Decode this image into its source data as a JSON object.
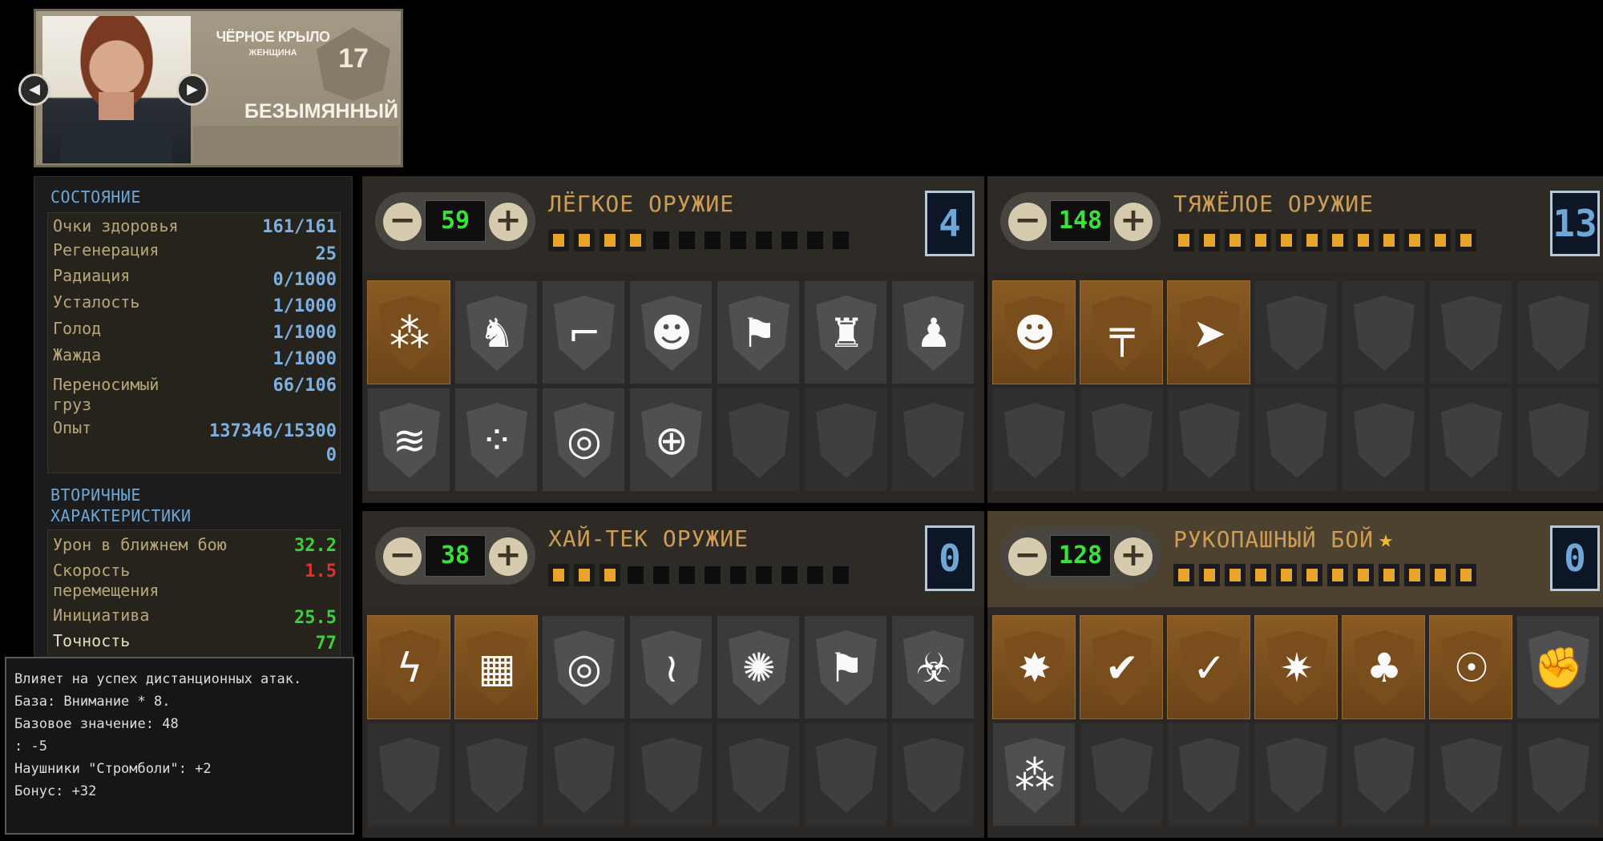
{
  "character": {
    "faction": "ЧЁРНОЕ КРЫЛО",
    "gender": "ЖЕНЩИНА",
    "level": "17",
    "name": "БЕЗЫМЯННЫЙ",
    "prev_icon": "chevron-left-icon",
    "next_icon": "chevron-right-icon"
  },
  "status": {
    "title": "СОСТОЯНИЕ",
    "rows": [
      {
        "label": "Очки здоровья",
        "value": "161/161"
      },
      {
        "label": "Регенерация",
        "value": "25"
      },
      {
        "label": "Радиация",
        "value": "0/1000"
      },
      {
        "label": "Усталость",
        "value": "1/1000"
      },
      {
        "label": "Голод",
        "value": "1/1000"
      },
      {
        "label": "Жажда",
        "value": "1/1000"
      },
      {
        "label": "Переносимый груз",
        "value": "66/106"
      },
      {
        "label": "Опыт",
        "value": "137346/153000"
      }
    ]
  },
  "secondary": {
    "title": "ВТОРИЧНЫЕ ХАРАКТЕРИСТИКИ",
    "rows": [
      {
        "label": "Урон в ближнем бою",
        "value": "32.2",
        "color": "#39d23a"
      },
      {
        "label": "Скорость перемещения",
        "value": "1.5",
        "color": "#e03030"
      },
      {
        "label": "Инициатива",
        "value": "25.5",
        "color": "#39d23a"
      },
      {
        "label": "Точность",
        "value": "77",
        "color": "#39d23a"
      }
    ]
  },
  "tooltip": {
    "lines": [
      "Влияет на успех дистанционных атак.",
      "База: Внимание * 8.",
      "",
      "Базовое значение: 48",
      ": -5",
      "Наушники \"Стромболи\": +2",
      "Бонус: +32"
    ]
  },
  "skills": [
    {
      "title": "ЛЁГКОЕ ОРУЖИЕ",
      "value": "59",
      "points": "4",
      "pips_filled": 4,
      "pips_total": 12,
      "starred": false,
      "perks": [
        {
          "icon": "gatling-icon",
          "state": "unlocked"
        },
        {
          "icon": "crouching-shooter-icon",
          "state": "available"
        },
        {
          "icon": "pistol-grip-icon",
          "state": "available"
        },
        {
          "icon": "headshot-icon",
          "state": "available"
        },
        {
          "icon": "arm-shot-icon",
          "state": "available"
        },
        {
          "icon": "ammo-soldier-icon",
          "state": "available"
        },
        {
          "icon": "kneeling-soldier-icon",
          "state": "available"
        },
        {
          "icon": "lightning-bullets-icon",
          "state": "available"
        },
        {
          "icon": "spray-icon",
          "state": "available"
        },
        {
          "icon": "target-icon",
          "state": "available"
        },
        {
          "icon": "crosshair-icon",
          "state": "available"
        },
        {
          "icon": "empty-slot-icon",
          "state": "empty"
        },
        {
          "icon": "empty-slot-icon",
          "state": "empty"
        },
        {
          "icon": "empty-slot-icon",
          "state": "empty"
        }
      ]
    },
    {
      "title": "ТЯЖЁЛОЕ ОРУЖИЕ",
      "value": "148",
      "points": "13",
      "pips_filled": 12,
      "pips_total": 12,
      "starred": false,
      "perks": [
        {
          "icon": "headshot-icon",
          "state": "unlocked"
        },
        {
          "icon": "smg-icon",
          "state": "unlocked"
        },
        {
          "icon": "rocket-icon",
          "state": "unlocked"
        },
        {
          "icon": "empty-slot-icon",
          "state": "empty"
        },
        {
          "icon": "empty-slot-icon",
          "state": "empty"
        },
        {
          "icon": "empty-slot-icon",
          "state": "empty"
        },
        {
          "icon": "empty-slot-icon",
          "state": "empty"
        },
        {
          "icon": "empty-slot-icon",
          "state": "empty"
        },
        {
          "icon": "empty-slot-icon",
          "state": "empty"
        },
        {
          "icon": "empty-slot-icon",
          "state": "empty"
        },
        {
          "icon": "empty-slot-icon",
          "state": "empty"
        },
        {
          "icon": "empty-slot-icon",
          "state": "empty"
        },
        {
          "icon": "empty-slot-icon",
          "state": "empty"
        },
        {
          "icon": "empty-slot-icon",
          "state": "empty"
        }
      ]
    },
    {
      "title": "ХАЙ-ТЕК ОРУЖИЕ",
      "value": "38",
      "points": "0",
      "pips_filled": 3,
      "pips_total": 12,
      "starred": false,
      "perks": [
        {
          "icon": "lightning-icon",
          "state": "unlocked"
        },
        {
          "icon": "chip-icon",
          "state": "unlocked"
        },
        {
          "icon": "target-icon",
          "state": "available"
        },
        {
          "icon": "heat-waves-icon",
          "state": "available"
        },
        {
          "icon": "burst-icon",
          "state": "available"
        },
        {
          "icon": "arm-shot-icon",
          "state": "available"
        },
        {
          "icon": "biohazard-icon",
          "state": "available"
        },
        {
          "icon": "empty-slot-icon",
          "state": "empty"
        },
        {
          "icon": "empty-slot-icon",
          "state": "empty"
        },
        {
          "icon": "empty-slot-icon",
          "state": "empty"
        },
        {
          "icon": "empty-slot-icon",
          "state": "empty"
        },
        {
          "icon": "empty-slot-icon",
          "state": "empty"
        },
        {
          "icon": "empty-slot-icon",
          "state": "empty"
        },
        {
          "icon": "empty-slot-icon",
          "state": "empty"
        }
      ]
    },
    {
      "title": "РУКОПАШНЫЙ БОЙ",
      "value": "128",
      "points": "0",
      "pips_filled": 12,
      "pips_total": 12,
      "starred": true,
      "perks": [
        {
          "icon": "impact-icon",
          "state": "unlocked"
        },
        {
          "icon": "check-icon",
          "state": "unlocked"
        },
        {
          "icon": "circled-check-icon",
          "state": "unlocked"
        },
        {
          "icon": "smash-icon",
          "state": "unlocked"
        },
        {
          "icon": "brass-knuckles-icon",
          "state": "unlocked"
        },
        {
          "icon": "double-punch-icon",
          "state": "unlocked"
        },
        {
          "icon": "fist-icon",
          "state": "available"
        },
        {
          "icon": "rocks-icon",
          "state": "available"
        },
        {
          "icon": "empty-slot-icon",
          "state": "empty"
        },
        {
          "icon": "empty-slot-icon",
          "state": "empty"
        },
        {
          "icon": "empty-slot-icon",
          "state": "empty"
        },
        {
          "icon": "empty-slot-icon",
          "state": "empty"
        },
        {
          "icon": "empty-slot-icon",
          "state": "empty"
        },
        {
          "icon": "empty-slot-icon",
          "state": "empty"
        }
      ]
    }
  ],
  "ui": {
    "minus_label": "−",
    "plus_label": "+",
    "star_glyph": "★"
  }
}
